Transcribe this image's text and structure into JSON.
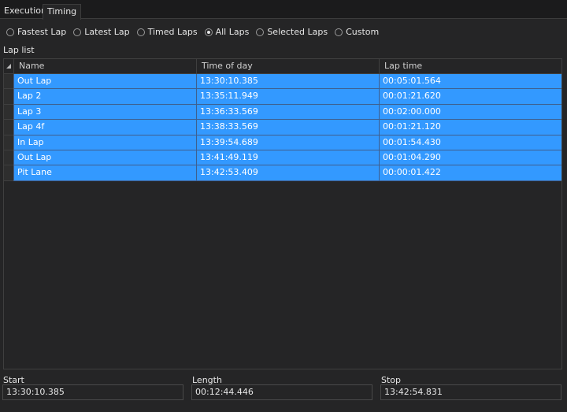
{
  "tabs": [
    "Execution",
    "Timing"
  ],
  "active_tab": "Timing",
  "filters": [
    {
      "label": "Fastest Lap",
      "checked": false
    },
    {
      "label": "Latest Lap",
      "checked": false
    },
    {
      "label": "Timed Laps",
      "checked": false
    },
    {
      "label": "All Laps",
      "checked": true
    },
    {
      "label": "Selected Laps",
      "checked": false
    },
    {
      "label": "Custom",
      "checked": false
    }
  ],
  "lap_list": {
    "title": "Lap list",
    "columns": [
      "Name",
      "Time of day",
      "Lap time"
    ],
    "rows": [
      [
        "Out Lap",
        "13:30:10.385",
        "00:05:01.564"
      ],
      [
        "Lap 2",
        "13:35:11.949",
        "00:01:21.620"
      ],
      [
        "Lap 3",
        "13:36:33.569",
        "00:02:00.000"
      ],
      [
        "Lap 4f",
        "13:38:33.569",
        "00:01:21.120"
      ],
      [
        "In Lap",
        "13:39:54.689",
        "00:01:54.430"
      ],
      [
        "Out Lap",
        "13:41:49.119",
        "00:01:04.290"
      ],
      [
        "Pit Lane",
        "13:42:53.409",
        "00:00:01.422"
      ]
    ]
  },
  "summary": {
    "start_label": "Start",
    "start": "13:30:10.385",
    "length_label": "Length",
    "length": "00:12:44.446",
    "stop_label": "Stop",
    "stop": "13:42:54.831"
  }
}
